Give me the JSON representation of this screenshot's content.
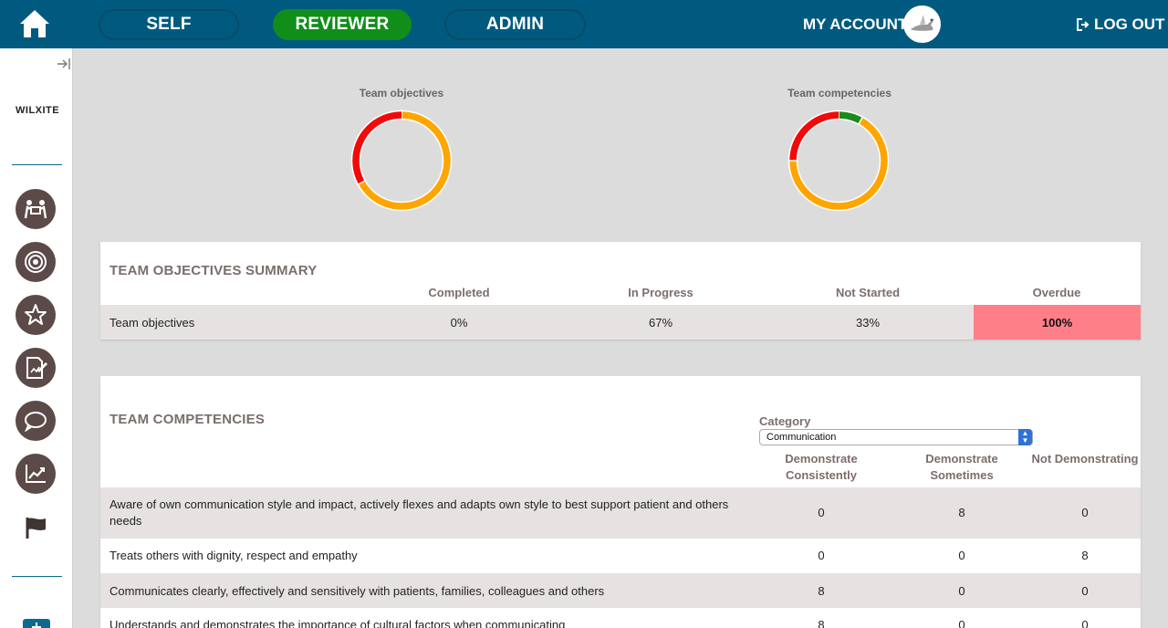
{
  "header": {
    "tabs": [
      {
        "label": "SELF",
        "active": false
      },
      {
        "label": "REVIEWER",
        "active": true
      },
      {
        "label": "ADMIN",
        "active": false
      }
    ],
    "account_label": "MY ACCOUNT",
    "logout_label": "LOG OUT",
    "colors": {
      "bar": "#005a7f",
      "active_tab": "#118e1a"
    }
  },
  "sidebar": {
    "brand": "WILXITE",
    "items": [
      {
        "icon": "team-icon"
      },
      {
        "icon": "target-icon"
      },
      {
        "icon": "star-icon"
      },
      {
        "icon": "document-edit-icon"
      },
      {
        "icon": "chat-icon"
      },
      {
        "icon": "trend-chart-icon"
      },
      {
        "icon": "flag-icon"
      }
    ]
  },
  "charts": {
    "objectives": {
      "title": "Team objectives",
      "chart_data": {
        "type": "pie",
        "donut": true,
        "slices": [
          {
            "label": "In Progress",
            "value": 67,
            "color": "#ffa500"
          },
          {
            "label": "Not Started",
            "value": 33,
            "color": "#f20a0a"
          }
        ]
      }
    },
    "competencies": {
      "title": "Team competencies",
      "chart_data": {
        "type": "pie",
        "donut": true,
        "slices": [
          {
            "label": "Demonstrate Consistently",
            "value": 8,
            "color": "#198c19"
          },
          {
            "label": "Demonstrate Sometimes",
            "value": 67,
            "color": "#ffa500"
          },
          {
            "label": "Not Demonstrating",
            "value": 25,
            "color": "#f20a0a"
          }
        ]
      }
    }
  },
  "objectives_summary": {
    "title": "TEAM OBJECTIVES SUMMARY",
    "columns": [
      "Completed",
      "In Progress",
      "Not Started",
      "Overdue"
    ],
    "row": {
      "label": "Team objectives",
      "completed": "0%",
      "in_progress": "67%",
      "not_started": "33%",
      "overdue": "100%"
    },
    "overdue_color": "#ff7f89"
  },
  "competencies": {
    "title": "TEAM COMPETENCIES",
    "category_label": "Category",
    "category_value": "Communication",
    "columns": [
      "Demonstrate Consistently",
      "Demonstrate Sometimes",
      "Not Demonstrating"
    ],
    "rows": [
      {
        "text": "Aware of own communication style and impact, actively flexes and adapts own style to best support patient and others needs",
        "consistently": "0",
        "sometimes": "8",
        "not": "0"
      },
      {
        "text": "Treats others with dignity, respect and empathy",
        "consistently": "0",
        "sometimes": "0",
        "not": "8"
      },
      {
        "text": "Communicates clearly, effectively and sensitively with patients, families, colleagues and others",
        "consistently": "8",
        "sometimes": "0",
        "not": "0"
      },
      {
        "text": "Understands and demonstrates the importance of cultural factors when communicating",
        "consistently": "8",
        "sometimes": "0",
        "not": "0"
      }
    ]
  }
}
